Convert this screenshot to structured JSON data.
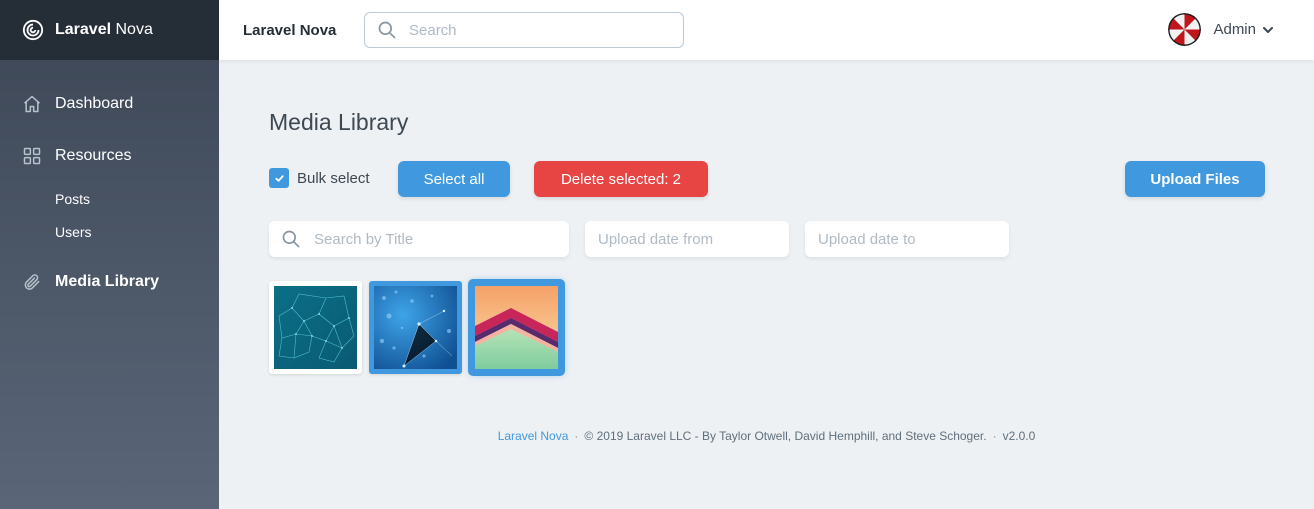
{
  "brand": {
    "name_bold": "Laravel",
    "name_light": " Nova"
  },
  "sidebar": {
    "items": [
      {
        "label": "Dashboard",
        "icon": "home-icon"
      },
      {
        "label": "Resources",
        "icon": "grid-icon"
      },
      {
        "label": "Media Library",
        "icon": "paperclip-icon"
      }
    ],
    "sub_items": [
      "Posts",
      "Users"
    ]
  },
  "topbar": {
    "title": "Laravel Nova",
    "search_placeholder": "Search",
    "user_name": "Admin"
  },
  "page": {
    "title": "Media Library",
    "bulk_label": "Bulk select",
    "bulk_checked": true,
    "select_all_label": "Select all",
    "delete_label": "Delete selected: 2",
    "upload_label": "Upload Files"
  },
  "filters": {
    "title_placeholder": "Search by Title",
    "date_from_placeholder": "Upload date from",
    "date_to_placeholder": "Upload date to"
  },
  "media": [
    {
      "selected": false
    },
    {
      "selected": true
    },
    {
      "selected": true
    }
  ],
  "footer": {
    "link": "Laravel Nova",
    "copyright": "© 2019 Laravel LLC - By Taylor Otwell, David Hemphill, and Steve Schoger.",
    "version": "v2.0.0"
  },
  "colors": {
    "primary": "#4099de",
    "danger": "#e74444",
    "sidebar_top": "#3c4655",
    "brand_bar": "#252d37"
  }
}
